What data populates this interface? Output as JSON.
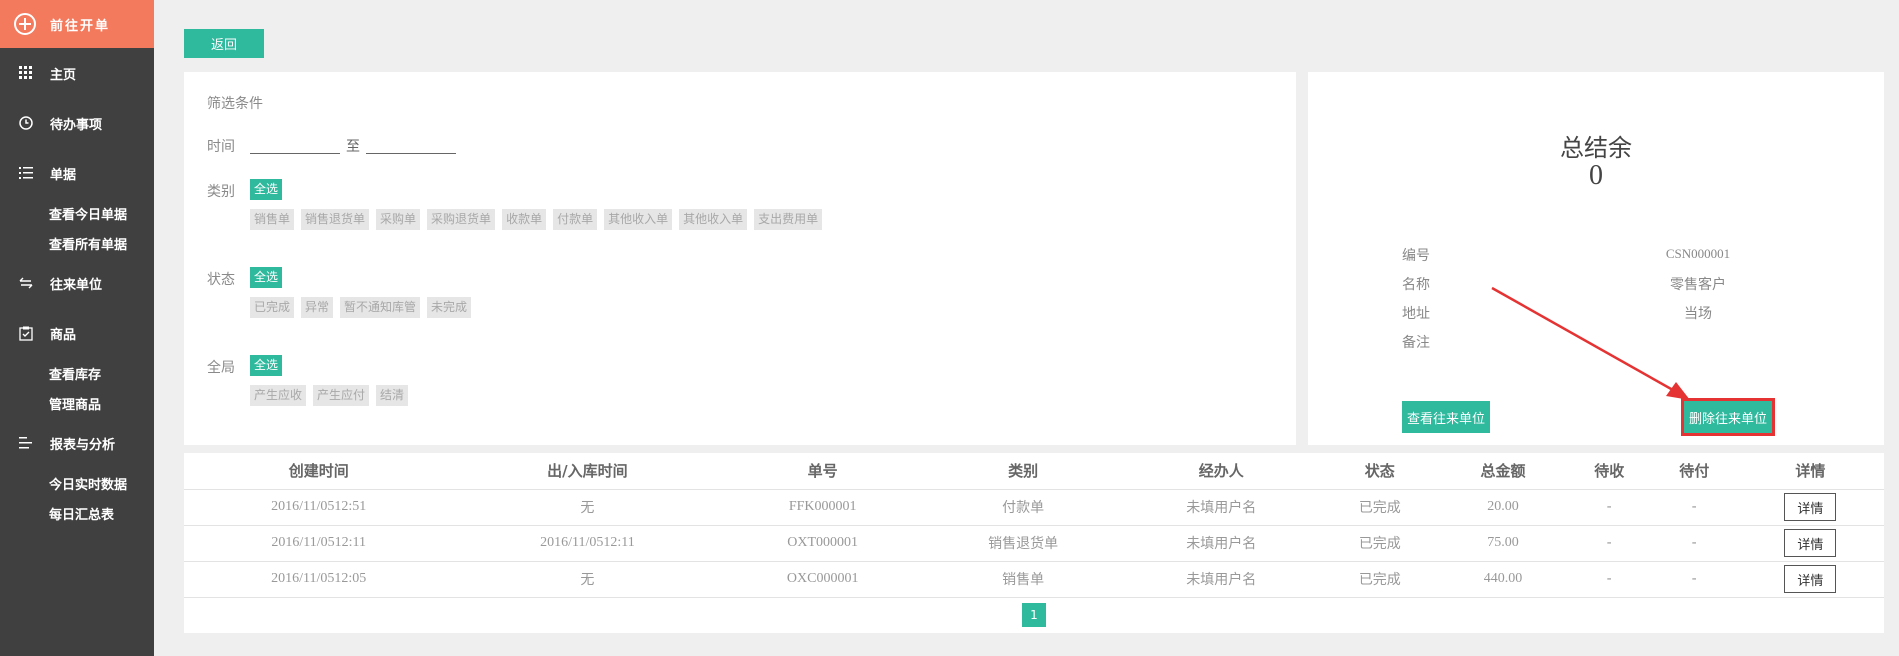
{
  "sidebar": {
    "top_button": "前往开单",
    "items": [
      {
        "label": "主页"
      },
      {
        "label": "待办事项"
      },
      {
        "label": "单据"
      },
      {
        "label": "查看今日单据"
      },
      {
        "label": "查看所有单据"
      },
      {
        "label": "往来单位"
      },
      {
        "label": "商品"
      },
      {
        "label": "查看库存"
      },
      {
        "label": "管理商品"
      },
      {
        "label": "报表与分析"
      },
      {
        "label": "今日实时数据"
      },
      {
        "label": "每日汇总表"
      }
    ]
  },
  "return_button": "返回",
  "filter": {
    "title": "筛选条件",
    "time_label": "时间",
    "time_to": "至",
    "category_label": "类别",
    "category_all": "全选",
    "categories": [
      "销售单",
      "销售退货单",
      "采购单",
      "采购退货单",
      "收款单",
      "付款单",
      "其他收入单",
      "其他收入单",
      "支出费用单"
    ],
    "status_label": "状态",
    "status_all": "全选",
    "statuses": [
      "已完成",
      "异常",
      "暂不通知库管",
      "未完成"
    ],
    "global_label": "全局",
    "global_all": "全选",
    "globals": [
      "产生应收",
      "产生应付",
      "结清"
    ]
  },
  "summary": {
    "title": "总结余",
    "value": "0",
    "fields": [
      {
        "label": "编号",
        "value": "CSN000001"
      },
      {
        "label": "名称",
        "value": "零售客户"
      },
      {
        "label": "地址",
        "value": "当场"
      },
      {
        "label": "备注",
        "value": ""
      }
    ],
    "view_button": "查看往来单位",
    "delete_button": "删除往来单位"
  },
  "table": {
    "headers": [
      "创建时间",
      "出/入库时间",
      "单号",
      "类别",
      "经办人",
      "状态",
      "总金额",
      "待收",
      "待付",
      "详情"
    ],
    "rows": [
      {
        "created": "2016/11/0512:51",
        "io_time": "无",
        "number": "FFK000001",
        "type": "付款单",
        "handler": "未填用户名",
        "status": "已完成",
        "total": "20.00",
        "receivable": "-",
        "payable": "-",
        "detail": "详情"
      },
      {
        "created": "2016/11/0512:11",
        "io_time": "2016/11/0512:11",
        "number": "OXT000001",
        "type": "销售退货单",
        "handler": "未填用户名",
        "status": "已完成",
        "total": "75.00",
        "receivable": "-",
        "payable": "-",
        "detail": "详情"
      },
      {
        "created": "2016/11/0512:05",
        "io_time": "无",
        "number": "OXC000001",
        "type": "销售单",
        "handler": "未填用户名",
        "status": "已完成",
        "total": "440.00",
        "receivable": "-",
        "payable": "-",
        "detail": "详情"
      }
    ],
    "page": "1"
  },
  "colors": {
    "accent": "#2fb99d",
    "sidebar_bg": "#404040",
    "top_button_bg": "#f47a5e",
    "highlight_red": "#e53333"
  }
}
